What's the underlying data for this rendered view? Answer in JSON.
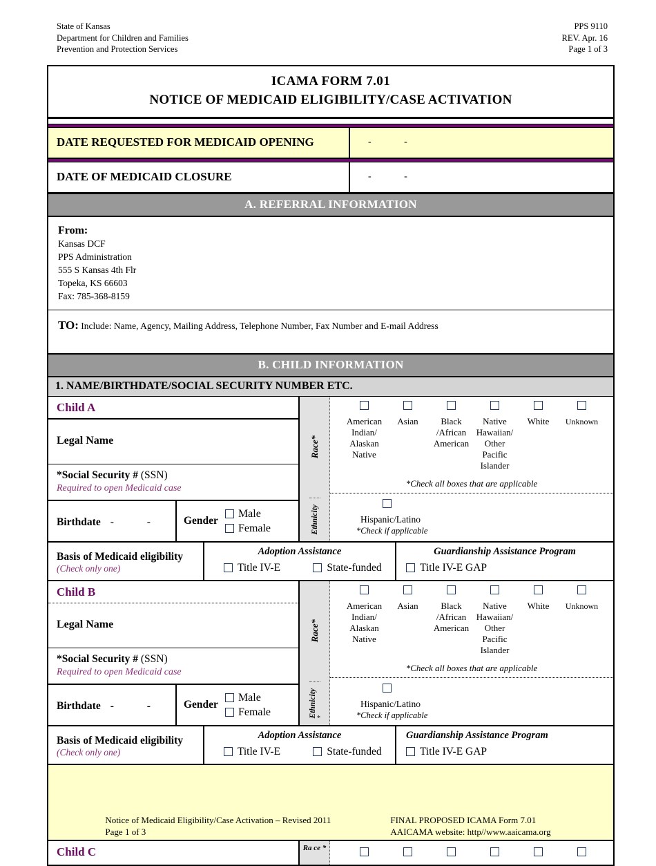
{
  "letterhead": {
    "left": [
      "State of Kansas",
      "Department for Children and Families",
      "Prevention and Protection Services"
    ],
    "right": [
      "PPS 9110",
      "REV. Apr. 16",
      "Page 1 of 3"
    ]
  },
  "title": {
    "line1": "ICAMA FORM 7.01",
    "line2": "NOTICE OF MEDICAID ELIGIBILITY/CASE ACTIVATION"
  },
  "dates": {
    "requested_label": "DATE REQUESTED FOR MEDICAID OPENING",
    "requested_value": "-  -",
    "closure_label": "DATE OF MEDICAID CLOSURE",
    "closure_value": "-  -"
  },
  "section_a": {
    "bar": "A. REFERRAL INFORMATION",
    "from_label": "From:",
    "from_lines": [
      "Kansas DCF",
      "PPS Administration",
      "555 S Kansas 4th Flr",
      "Topeka, KS 66603",
      "Fax: 785-368-8159"
    ],
    "to_label": "TO:",
    "to_text": "Include: Name, Agency, Mailing Address, Telephone Number, Fax Number and E-mail Address"
  },
  "section_b": {
    "bar": "B. CHILD INFORMATION",
    "subsection": "1. NAME/BIRTHDATE/SOCIAL SECURITY NUMBER ETC."
  },
  "labels": {
    "legal_name": "Legal Name",
    "ssn_main": "*Social Security # ",
    "ssn_paren": "(SSN)",
    "ssn_note": "Required to open Medicaid case",
    "birthdate": "Birthdate",
    "birthdate_dashes": "-  -",
    "gender": "Gender",
    "male": "Male",
    "female": "Female",
    "race_band": "Race*",
    "ethnicity_band": "Ethnicity",
    "ethnicity_band_b": "Ethnicity",
    "ethnicity_band_b_star": "*",
    "hispanic": "Hispanic/Latino",
    "hispanic_note": "*Check if applicable",
    "race_note": "*Check all boxes that are applicable",
    "basis_main": "Basis of Medicaid eligibility",
    "basis_sub": "(Check only one)",
    "adoption_assistance": "Adoption Assistance",
    "guardianship_program": "Guardianship Assistance Program",
    "title_ive": "Title IV-E",
    "state_funded": "State-funded",
    "title_ive_gap": "Title IV-E GAP"
  },
  "race_options": [
    {
      "label": "American Indian/ Alaskan Native",
      "narrow": false
    },
    {
      "label": "Asian",
      "narrow": false
    },
    {
      "label": "Black /African American",
      "narrow": false
    },
    {
      "label": "Native Hawaiian/ Other Pacific Islander",
      "narrow": false
    },
    {
      "label": "White",
      "narrow": false
    },
    {
      "label": "Unknown",
      "narrow": true
    }
  ],
  "children": [
    {
      "heading": "Child A"
    },
    {
      "heading": "Child B"
    },
    {
      "heading": "Child C"
    }
  ],
  "child_c_band": [
    "Ra",
    "ce *"
  ],
  "footer": {
    "left_line1": "Notice of Medicaid Eligibility/Case Activation – Revised 2011",
    "left_line2": "Page 1 of 3",
    "right_line1": "FINAL PROPOSED ICAMA Form 7.01",
    "right_line2": "AAICAMA website: http//www.aaicama.org"
  },
  "colors": {
    "purple_bar": "#6b0d6b",
    "heading_purple": "#6b0d60",
    "note_purple": "#8b2f78",
    "highlight_yellow": "#ffffcc",
    "section_gray": "#999999",
    "subsection_gray": "#d4d4d4",
    "band_gray": "#e2e2e2",
    "checkbox_blue": "#1f3864"
  }
}
